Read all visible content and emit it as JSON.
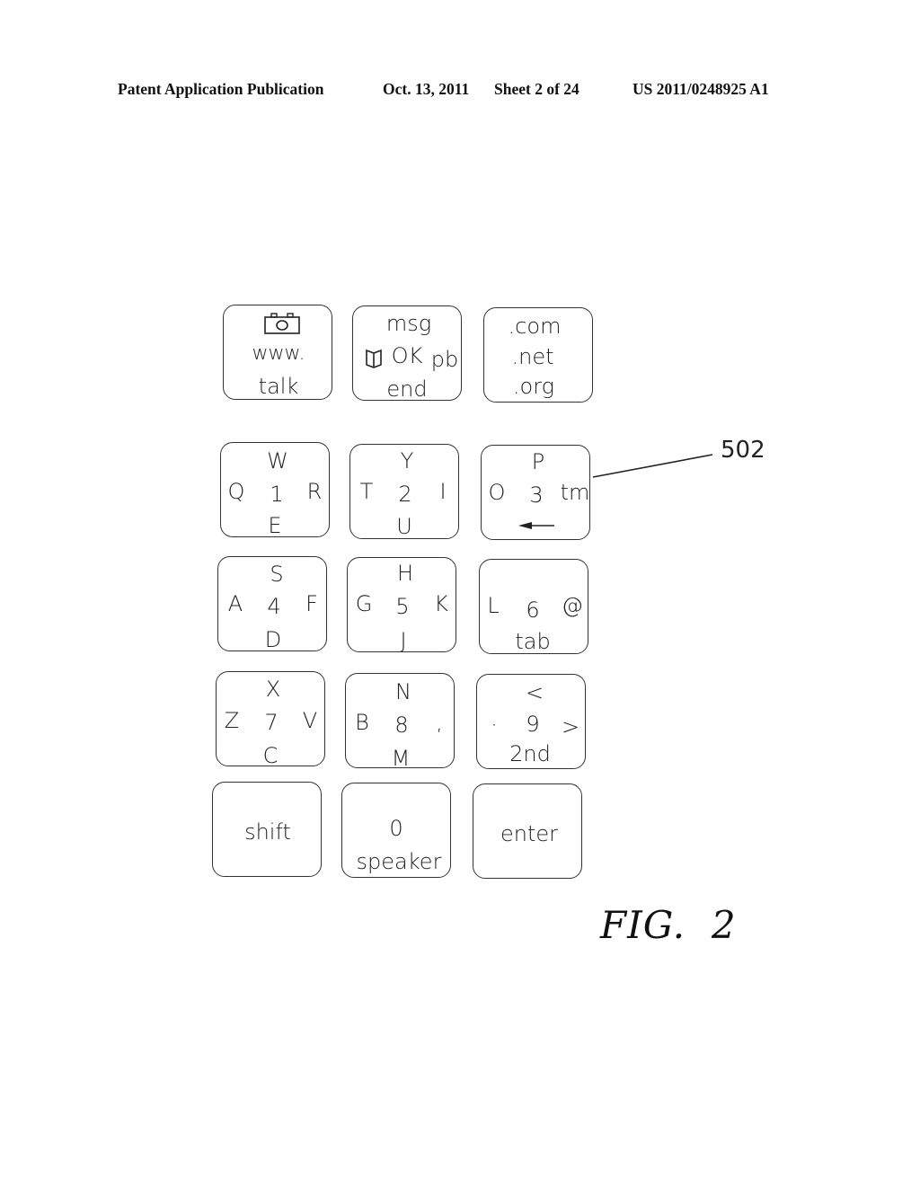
{
  "header": {
    "publication": "Patent Application Publication",
    "date": "Oct. 13, 2011",
    "sheet": "Sheet 2 of 24",
    "number": "US 2011/0248925 A1"
  },
  "figure_label": "FIG.  2",
  "reference_numeral": "502",
  "keys": {
    "camera": {
      "icon": "camera-icon",
      "mid": "www.",
      "bottom": "talk"
    },
    "msg": {
      "top": "msg",
      "icon": "book-icon",
      "mid": "OK",
      "right": "pb",
      "bottom": "end"
    },
    "domains": {
      "top": ".com",
      "mid": ".net",
      "bottom": ".org"
    },
    "k1": {
      "top": "W",
      "left": "Q",
      "center": "1",
      "right": "R",
      "bottom": "E"
    },
    "k2": {
      "top": "Y",
      "left": "T",
      "center": "2",
      "right": "I",
      "bottom": "U"
    },
    "k3": {
      "top": "P",
      "left": "O",
      "center": "3",
      "right": "tm",
      "bottom_icon": "left-arrow-icon"
    },
    "k4": {
      "top": "S",
      "left": "A",
      "center": "4",
      "right": "F",
      "bottom": "D"
    },
    "k5": {
      "top": "H",
      "left": "G",
      "center": "5",
      "right": "K",
      "bottom": "J"
    },
    "k6": {
      "left": "L",
      "center": "6",
      "right": "@",
      "bottom": "tab"
    },
    "k7": {
      "top": "X",
      "left": "Z",
      "center": "7",
      "right": "V",
      "bottom": "C"
    },
    "k8": {
      "top": "N",
      "left": "B",
      "center": "8",
      "right": ",",
      "bottom": "M"
    },
    "k9": {
      "top": "<",
      "left": "·",
      "center": "9",
      "right": ">",
      "bottom": "2nd"
    },
    "shift": {
      "label": "shift"
    },
    "zero": {
      "top": "0",
      "bottom": "speaker"
    },
    "enter": {
      "label": "enter"
    }
  }
}
